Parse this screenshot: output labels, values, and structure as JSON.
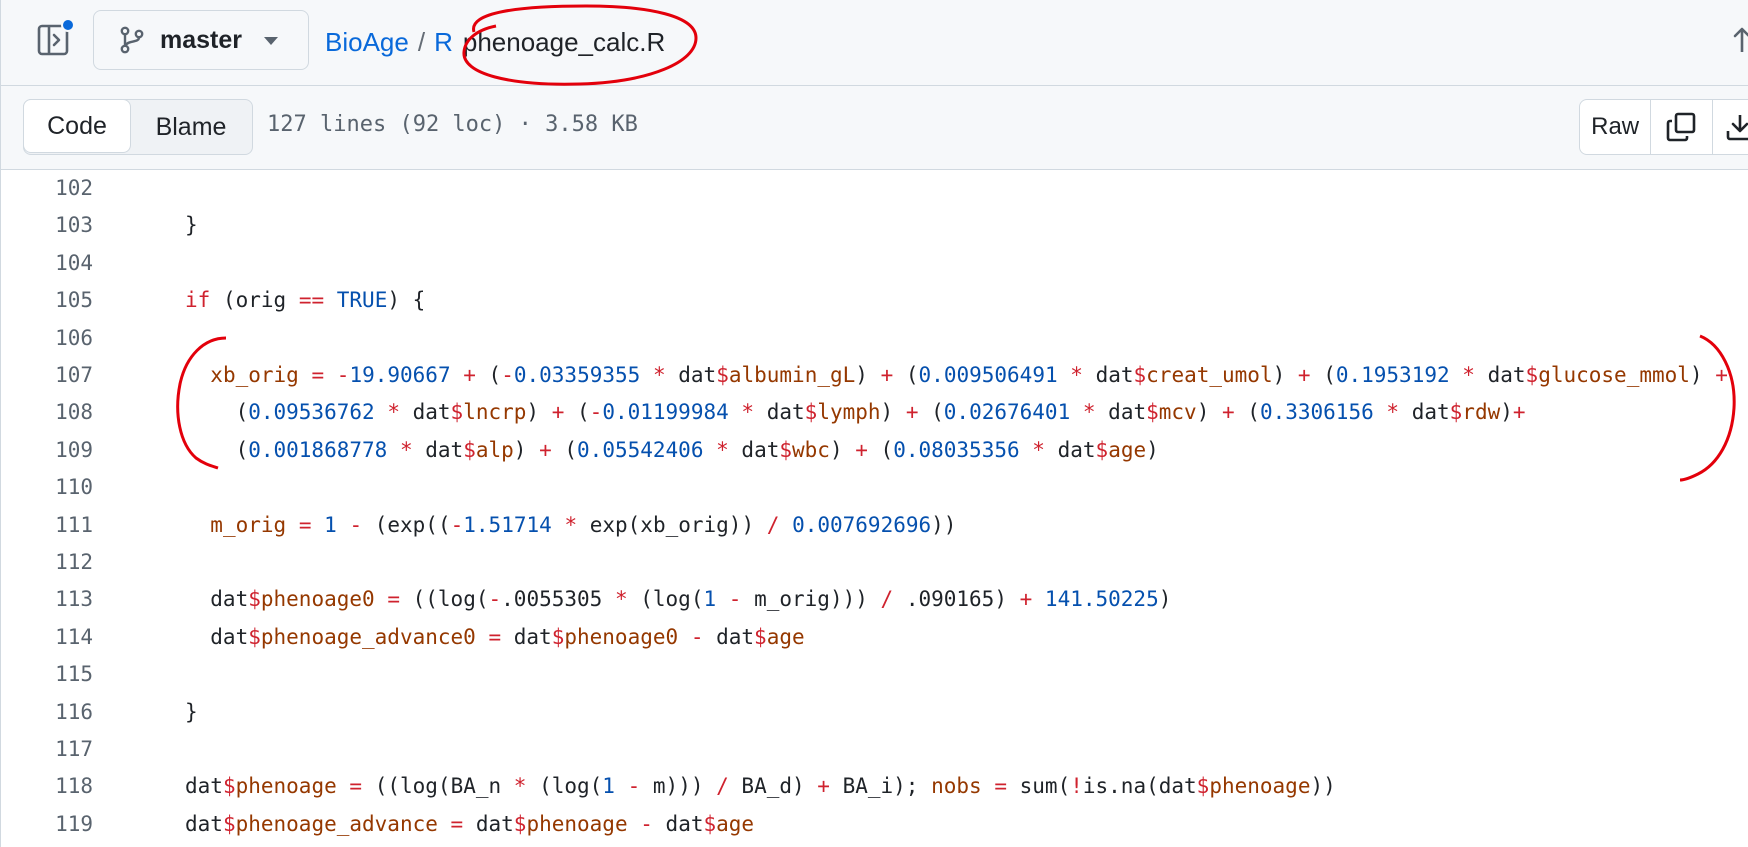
{
  "header": {
    "branch": "master",
    "breadcrumb": {
      "repo": "BioAge",
      "folder": "R",
      "separator": "/",
      "file": "phenoage_calc.R"
    }
  },
  "toolbar": {
    "code_tab": "Code",
    "blame_tab": "Blame",
    "file_meta": "127 lines (92 loc) · 3.58 KB",
    "raw_label": "Raw"
  },
  "icons": {
    "panel": "sidebar-toggle-icon",
    "branch": "git-branch-icon",
    "caret": "triangle-down-icon",
    "up": "arrow-up-icon",
    "copy": "copy-icon",
    "download": "download-icon"
  },
  "colors": {
    "link": "#0969da",
    "keyword": "#cf222e",
    "number": "#0550ae",
    "variable": "#953800",
    "annotation": "#e3000b"
  },
  "code": {
    "lines": [
      {
        "num": "102",
        "tokens": []
      },
      {
        "num": "103",
        "tokens": [
          [
            "",
            "}"
          ]
        ]
      },
      {
        "num": "104",
        "tokens": []
      },
      {
        "num": "105",
        "tokens": [
          [
            "k",
            "if"
          ],
          [
            "",
            " (orig "
          ],
          [
            "o",
            "=="
          ],
          [
            "",
            " "
          ],
          [
            "n",
            "TRUE"
          ],
          [
            "",
            ") {"
          ]
        ]
      },
      {
        "num": "106",
        "tokens": []
      },
      {
        "num": "107",
        "tokens": [
          [
            "",
            "  "
          ],
          [
            "v",
            "xb_orig"
          ],
          [
            "",
            " "
          ],
          [
            "o",
            "="
          ],
          [
            "",
            " "
          ],
          [
            "o",
            "-"
          ],
          [
            "n",
            "19.90667"
          ],
          [
            "",
            " "
          ],
          [
            "o",
            "+"
          ],
          [
            "",
            " ("
          ],
          [
            "o",
            "-"
          ],
          [
            "n",
            "0.03359355"
          ],
          [
            "",
            " "
          ],
          [
            "o",
            "*"
          ],
          [
            "",
            " dat"
          ],
          [
            "o",
            "$"
          ],
          [
            "v",
            "albumin_gL"
          ],
          [
            "",
            ") "
          ],
          [
            "o",
            "+"
          ],
          [
            "",
            " ("
          ],
          [
            "n",
            "0.009506491"
          ],
          [
            "",
            " "
          ],
          [
            "o",
            "*"
          ],
          [
            "",
            " dat"
          ],
          [
            "o",
            "$"
          ],
          [
            "v",
            "creat_umol"
          ],
          [
            "",
            ") "
          ],
          [
            "o",
            "+"
          ],
          [
            "",
            " ("
          ],
          [
            "n",
            "0.1953192"
          ],
          [
            "",
            " "
          ],
          [
            "o",
            "*"
          ],
          [
            "",
            " dat"
          ],
          [
            "o",
            "$"
          ],
          [
            "v",
            "glucose_mmol"
          ],
          [
            "",
            ") "
          ],
          [
            "o",
            "+"
          ]
        ]
      },
      {
        "num": "108",
        "tokens": [
          [
            "",
            "    ("
          ],
          [
            "n",
            "0.09536762"
          ],
          [
            "",
            " "
          ],
          [
            "o",
            "*"
          ],
          [
            "",
            " dat"
          ],
          [
            "o",
            "$"
          ],
          [
            "v",
            "lncrp"
          ],
          [
            "",
            ") "
          ],
          [
            "o",
            "+"
          ],
          [
            "",
            " ("
          ],
          [
            "o",
            "-"
          ],
          [
            "n",
            "0.01199984"
          ],
          [
            "",
            " "
          ],
          [
            "o",
            "*"
          ],
          [
            "",
            " dat"
          ],
          [
            "o",
            "$"
          ],
          [
            "v",
            "lymph"
          ],
          [
            "",
            ") "
          ],
          [
            "o",
            "+"
          ],
          [
            "",
            " ("
          ],
          [
            "n",
            "0.02676401"
          ],
          [
            "",
            " "
          ],
          [
            "o",
            "*"
          ],
          [
            "",
            " dat"
          ],
          [
            "o",
            "$"
          ],
          [
            "v",
            "mcv"
          ],
          [
            "",
            ") "
          ],
          [
            "o",
            "+"
          ],
          [
            "",
            " ("
          ],
          [
            "n",
            "0.3306156"
          ],
          [
            "",
            " "
          ],
          [
            "o",
            "*"
          ],
          [
            "",
            " dat"
          ],
          [
            "o",
            "$"
          ],
          [
            "v",
            "rdw"
          ],
          [
            "",
            ")"
          ],
          [
            "o",
            "+"
          ]
        ]
      },
      {
        "num": "109",
        "tokens": [
          [
            "",
            "    ("
          ],
          [
            "n",
            "0.001868778"
          ],
          [
            "",
            " "
          ],
          [
            "o",
            "*"
          ],
          [
            "",
            " dat"
          ],
          [
            "o",
            "$"
          ],
          [
            "v",
            "alp"
          ],
          [
            "",
            ") "
          ],
          [
            "o",
            "+"
          ],
          [
            "",
            " ("
          ],
          [
            "n",
            "0.05542406"
          ],
          [
            "",
            " "
          ],
          [
            "o",
            "*"
          ],
          [
            "",
            " dat"
          ],
          [
            "o",
            "$"
          ],
          [
            "v",
            "wbc"
          ],
          [
            "",
            ") "
          ],
          [
            "o",
            "+"
          ],
          [
            "",
            " ("
          ],
          [
            "n",
            "0.08035356"
          ],
          [
            "",
            " "
          ],
          [
            "o",
            "*"
          ],
          [
            "",
            " dat"
          ],
          [
            "o",
            "$"
          ],
          [
            "v",
            "age"
          ],
          [
            "",
            ")"
          ]
        ]
      },
      {
        "num": "110",
        "tokens": []
      },
      {
        "num": "111",
        "tokens": [
          [
            "",
            "  "
          ],
          [
            "v",
            "m_orig"
          ],
          [
            "",
            " "
          ],
          [
            "o",
            "="
          ],
          [
            "",
            " "
          ],
          [
            "n",
            "1"
          ],
          [
            "",
            " "
          ],
          [
            "o",
            "-"
          ],
          [
            "",
            " (exp(("
          ],
          [
            "o",
            "-"
          ],
          [
            "n",
            "1.51714"
          ],
          [
            "",
            " "
          ],
          [
            "o",
            "*"
          ],
          [
            "",
            " exp(xb_orig)) "
          ],
          [
            "o",
            "/"
          ],
          [
            "",
            " "
          ],
          [
            "n",
            "0.007692696"
          ],
          [
            "",
            "))"
          ]
        ]
      },
      {
        "num": "112",
        "tokens": []
      },
      {
        "num": "113",
        "tokens": [
          [
            "",
            "  dat"
          ],
          [
            "o",
            "$"
          ],
          [
            "v",
            "phenoage0"
          ],
          [
            "",
            " "
          ],
          [
            "o",
            "="
          ],
          [
            "",
            " ((log("
          ],
          [
            "o",
            "-"
          ],
          [
            "",
            ".0055305 "
          ],
          [
            "o",
            "*"
          ],
          [
            "",
            " (log("
          ],
          [
            "n",
            "1"
          ],
          [
            "",
            " "
          ],
          [
            "o",
            "-"
          ],
          [
            "",
            " m_orig))) "
          ],
          [
            "o",
            "/"
          ],
          [
            "",
            " .090165) "
          ],
          [
            "o",
            "+"
          ],
          [
            "",
            " "
          ],
          [
            "n",
            "141.50225"
          ],
          [
            "",
            ")"
          ]
        ]
      },
      {
        "num": "114",
        "tokens": [
          [
            "",
            "  dat"
          ],
          [
            "o",
            "$"
          ],
          [
            "v",
            "phenoage_advance0"
          ],
          [
            "",
            " "
          ],
          [
            "o",
            "="
          ],
          [
            "",
            " dat"
          ],
          [
            "o",
            "$"
          ],
          [
            "v",
            "phenoage0"
          ],
          [
            "",
            " "
          ],
          [
            "o",
            "-"
          ],
          [
            "",
            " dat"
          ],
          [
            "o",
            "$"
          ],
          [
            "v",
            "age"
          ]
        ]
      },
      {
        "num": "115",
        "tokens": []
      },
      {
        "num": "116",
        "tokens": [
          [
            "",
            "}"
          ]
        ]
      },
      {
        "num": "117",
        "tokens": []
      },
      {
        "num": "118",
        "tokens": [
          [
            "",
            "dat"
          ],
          [
            "o",
            "$"
          ],
          [
            "v",
            "phenoage"
          ],
          [
            "",
            " "
          ],
          [
            "o",
            "="
          ],
          [
            "",
            " ((log(BA_n "
          ],
          [
            "o",
            "*"
          ],
          [
            "",
            " (log("
          ],
          [
            "n",
            "1"
          ],
          [
            "",
            " "
          ],
          [
            "o",
            "-"
          ],
          [
            "",
            " m))) "
          ],
          [
            "o",
            "/"
          ],
          [
            "",
            " BA_d) "
          ],
          [
            "o",
            "+"
          ],
          [
            "",
            " BA_i); "
          ],
          [
            "v",
            "nobs"
          ],
          [
            "",
            " "
          ],
          [
            "o",
            "="
          ],
          [
            "",
            " sum("
          ],
          [
            "o",
            "!"
          ],
          [
            "",
            "is.na(dat"
          ],
          [
            "o",
            "$"
          ],
          [
            "v",
            "phenoage"
          ],
          [
            "",
            "))"
          ]
        ]
      },
      {
        "num": "119",
        "tokens": [
          [
            "",
            "dat"
          ],
          [
            "o",
            "$"
          ],
          [
            "v",
            "phenoage_advance"
          ],
          [
            "",
            " "
          ],
          [
            "o",
            "="
          ],
          [
            "",
            " dat"
          ],
          [
            "o",
            "$"
          ],
          [
            "v",
            "phenoage"
          ],
          [
            "",
            " "
          ],
          [
            "o",
            "-"
          ],
          [
            "",
            " dat"
          ],
          [
            "o",
            "$"
          ],
          [
            "v",
            "age"
          ]
        ]
      }
    ]
  }
}
